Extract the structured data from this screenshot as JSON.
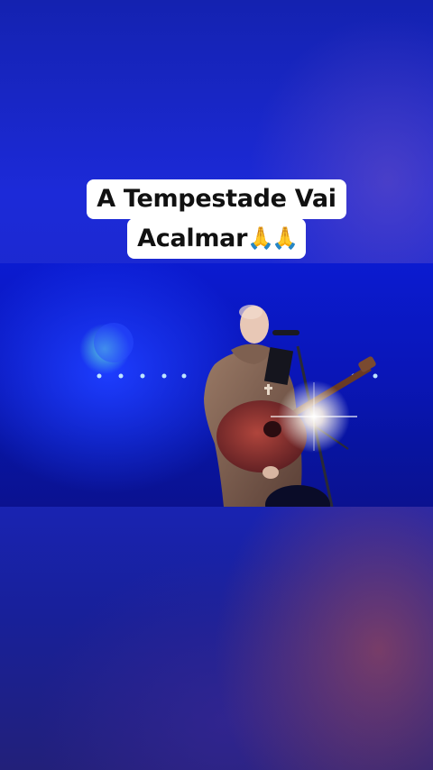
{
  "caption": {
    "line1": "A Tempestade Vai",
    "line2": "Acalmar",
    "emoji": "🙏🙏"
  },
  "video": {
    "description_icon": "concert-performer-frame"
  }
}
